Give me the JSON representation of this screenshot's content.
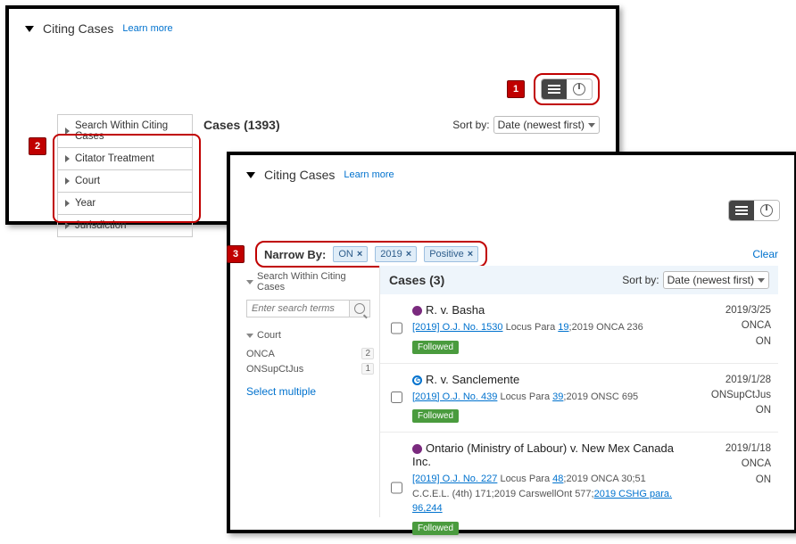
{
  "panelA": {
    "header_title": "Citing Cases",
    "learn_more": "Learn more",
    "callouts": {
      "one": "1",
      "two": "2"
    },
    "filters": {
      "search": "Search Within Citing Cases",
      "treatment": "Citator Treatment",
      "court": "Court",
      "year": "Year",
      "jurisdiction": "Jurisdiction"
    },
    "cases_label": "Cases (1393)",
    "sort_label": "Sort by:",
    "sort_value": "Date (newest first)"
  },
  "panelB": {
    "header_title": "Citing Cases",
    "learn_more": "Learn more",
    "callouts": {
      "three": "3"
    },
    "narrow_label": "Narrow By:",
    "chips": {
      "on": "ON",
      "year": "2019",
      "treat": "Positive"
    },
    "clear": "Clear",
    "cases_label": "Cases (3)",
    "sort_label": "Sort by:",
    "sort_value": "Date (newest first)",
    "side": {
      "search_section": "Search Within Citing Cases",
      "search_placeholder": "Enter search terms",
      "court_section": "Court",
      "court1": {
        "name": "ONCA",
        "count": "2"
      },
      "court2": {
        "name": "ONSupCtJus",
        "count": "1"
      },
      "select_multiple": "Select multiple"
    },
    "results": [
      {
        "title": "R. v. Basha",
        "cite_link1": "[2019] O.J. No. 1530",
        "cite_mid1": " Locus Para ",
        "cite_link2": "19",
        "cite_tail": ";2019 ONCA 236",
        "followed": "Followed",
        "date": "2019/3/25",
        "court": "ONCA",
        "juris": "ON",
        "dot": "purple"
      },
      {
        "title": "R. v. Sanclemente",
        "cite_link1": "[2019] O.J. No. 439",
        "cite_mid1": " Locus Para ",
        "cite_link2": "39",
        "cite_tail": ";2019 ONSC 695",
        "followed": "Followed",
        "date": "2019/1/28",
        "court": "ONSupCtJus",
        "juris": "ON",
        "dot": "blue"
      },
      {
        "title": "Ontario (Ministry of Labour) v. New Mex Canada Inc.",
        "cite_link1": "[2019] O.J. No. 227",
        "cite_mid1": " Locus Para ",
        "cite_link2": "48",
        "cite_tail": ";2019 ONCA 30;51 C.C.E.L. (4th) 171;2019 CarswellOnt 577;",
        "cite_link3": "2019 CSHG para. 96,244",
        "followed": "Followed",
        "date": "2019/1/18",
        "court": "ONCA",
        "juris": "ON",
        "dot": "purple"
      }
    ]
  }
}
